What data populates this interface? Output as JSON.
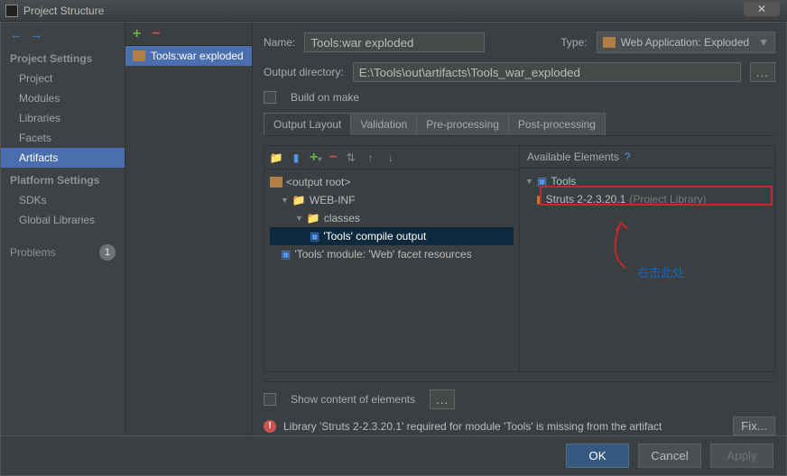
{
  "title": "Project Structure",
  "sidebar": {
    "heading1": "Project Settings",
    "items1": [
      "Project",
      "Modules",
      "Libraries",
      "Facets",
      "Artifacts"
    ],
    "heading2": "Platform Settings",
    "items2": [
      "SDKs",
      "Global Libraries"
    ],
    "problems_label": "Problems",
    "problems_count": "1"
  },
  "artifact_list": {
    "item": "Tools:war exploded"
  },
  "form": {
    "name_label": "Name:",
    "name_value": "Tools:war exploded",
    "type_label": "Type:",
    "type_value": "Web Application: Exploded",
    "outdir_label": "Output directory:",
    "outdir_value": "E:\\Tools\\out\\artifacts\\Tools_war_exploded",
    "build_on_make": "Build on make",
    "show_content": "Show content of elements"
  },
  "tabs": [
    "Output Layout",
    "Validation",
    "Pre-processing",
    "Post-processing"
  ],
  "left_tree": {
    "root": "<output root>",
    "webinf": "WEB-INF",
    "classes": "classes",
    "compile": "'Tools' compile output",
    "facet": "'Tools' module: 'Web' facet resources"
  },
  "right": {
    "header": "Available Elements",
    "tools": "Tools",
    "lib": "Struts 2-2.3.20.1",
    "lib_suffix": "(Project Library)"
  },
  "annotation": "右击此处",
  "warning": "Library 'Struts 2-2.3.20.1' required for module 'Tools' is missing from the artifact",
  "fix_label": "Fix...",
  "buttons": {
    "ok": "OK",
    "cancel": "Cancel",
    "apply": "Apply"
  }
}
